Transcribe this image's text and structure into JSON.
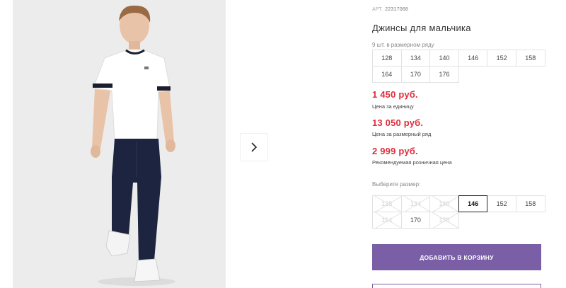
{
  "product": {
    "article_label": "АРТ.",
    "article_value": "22317068",
    "title": "Джинсы для мальчика",
    "row_note": "9 шт. в размерном ряду"
  },
  "size_row": [
    "128",
    "134",
    "140",
    "146",
    "152",
    "158",
    "164",
    "170",
    "176"
  ],
  "prices": {
    "unit_price": "1 450 руб.",
    "unit_label": "Цена за единицу",
    "row_price": "13 050 руб.",
    "row_label": "Цена за размерный ряд",
    "retail_price": "2 999 руб.",
    "retail_label": "Рекомендуемая розничная цена"
  },
  "size_picker": {
    "label": "Выберите размер:",
    "options": [
      {
        "value": "128",
        "state": "disabled"
      },
      {
        "value": "134",
        "state": "disabled"
      },
      {
        "value": "140",
        "state": "disabled"
      },
      {
        "value": "146",
        "state": "selected"
      },
      {
        "value": "152",
        "state": "available"
      },
      {
        "value": "158",
        "state": "available"
      },
      {
        "value": "164",
        "state": "disabled"
      },
      {
        "value": "170",
        "state": "available"
      },
      {
        "value": "176",
        "state": "disabled"
      }
    ]
  },
  "actions": {
    "add_to_cart": "ДОБАВИТЬ В КОРЗИНУ"
  },
  "colors": {
    "price": "#e12c3b",
    "accent": "#7a5fa6",
    "photo_background": "#ececec"
  },
  "icons": {
    "gallery_next": "chevron-right-icon"
  }
}
